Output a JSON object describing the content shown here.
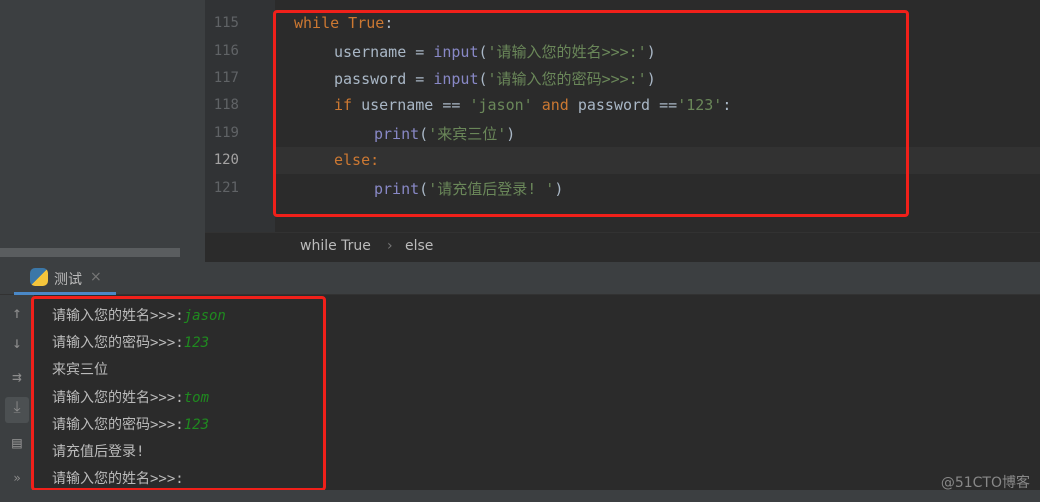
{
  "editor": {
    "lines": [
      {
        "num": "115",
        "text": "while True:"
      },
      {
        "num": "116",
        "text": "username = input('请输入您的姓名>>>:')"
      },
      {
        "num": "117",
        "text": "password = input('请输入您的密码>>>:')"
      },
      {
        "num": "118",
        "text": "if username == 'jason' and password =='123':"
      },
      {
        "num": "119",
        "text": "print('来宾三位')"
      },
      {
        "num": "120",
        "text": "else:"
      },
      {
        "num": "121",
        "text": "print('请充值后登录! ')"
      }
    ]
  },
  "breadcrumb": [
    "while True",
    "else"
  ],
  "run_tab": {
    "label": "测试",
    "icon": "python-icon"
  },
  "console": {
    "lines": [
      {
        "prompt": "请输入您的姓名>>>:",
        "input": "jason"
      },
      {
        "prompt": "请输入您的密码>>>:",
        "input": "123"
      },
      {
        "prompt": "来宾三位",
        "input": ""
      },
      {
        "prompt": "请输入您的姓名>>>:",
        "input": "tom"
      },
      {
        "prompt": "请输入您的密码>>>:",
        "input": "123"
      },
      {
        "prompt": "请充值后登录!",
        "input": ""
      },
      {
        "prompt": "请输入您的姓名>>>:",
        "input": ""
      }
    ]
  },
  "watermark": "@51CTO博客",
  "colors": {
    "highlight_box": "#f0201a",
    "user_input": "#1f8a1f",
    "keyword": "#cc7832",
    "string": "#6a8759"
  }
}
